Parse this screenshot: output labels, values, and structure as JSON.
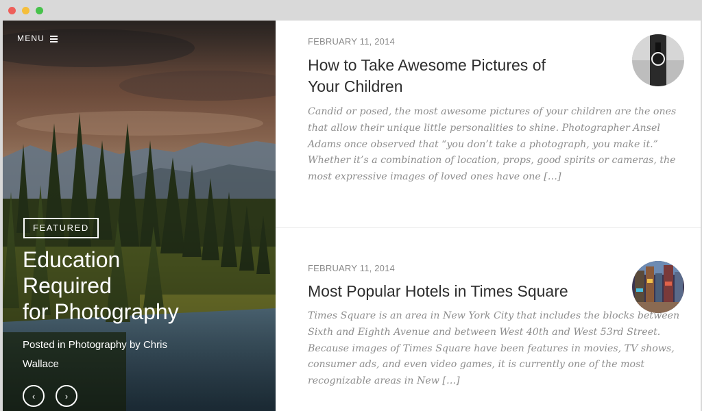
{
  "window": {
    "traffic_lights": [
      "#ee5f5a",
      "#f5be3a",
      "#47c24b"
    ]
  },
  "hero": {
    "menu_label": "MENU",
    "menu_icon": "hamburger-icon",
    "badge": "FEATURED",
    "title_lines": [
      "Education",
      "Required",
      "for Photography"
    ],
    "meta": "Posted in Photography by Chris Wallace",
    "prev_icon": "chevron-left-icon",
    "next_icon": "chevron-right-icon",
    "prev_glyph": "‹",
    "next_glyph": "›"
  },
  "posts": [
    {
      "date": "FEBRUARY 11, 2014",
      "title": "How to Take Awesome Pictures of Your Children",
      "excerpt": "Candid or posed, the most awesome pictures of your children are the ones that allow their unique little personalities to shine. Photographer Ansel Adams once observed that “you don’t take a photograph, you make it.” Whether it’s a combination of location, props, good spirits or cameras, the most expressive images of loved ones have one […]"
    },
    {
      "date": "FEBRUARY 11, 2014",
      "title": "Most Popular Hotels in Times Square",
      "excerpt": "Times Square is an area in New York City that includes the blocks between Sixth and Eighth Avenue and between West 40th and West 53rd Street. Because images of Times Square have been features in movies, TV shows, consumer ads, and even video games, it is currently one of the most recognizable areas in New […]"
    }
  ]
}
